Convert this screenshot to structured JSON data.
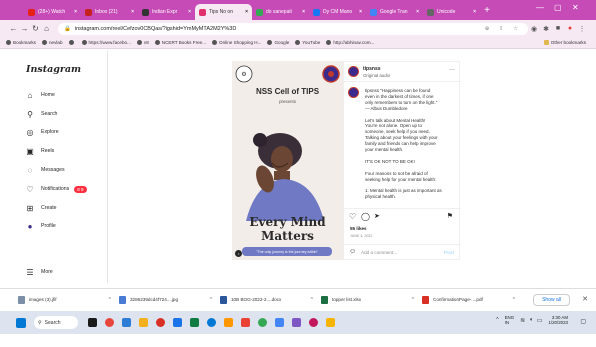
{
  "browser": {
    "tabs": [
      {
        "label": "(28+) Watch",
        "color": "#e62117",
        "active": false
      },
      {
        "label": "Inbox (21)",
        "color": "#c5221f",
        "active": false
      },
      {
        "label": "Indian Expr",
        "color": "#333333",
        "active": false
      },
      {
        "label": "Tips No on",
        "color": "#e1306c",
        "active": true
      },
      {
        "label": "do sanepati",
        "color": "#34a853",
        "active": false
      },
      {
        "label": "Dy CM Mano",
        "color": "#1877f2",
        "active": false
      },
      {
        "label": "Google Tran",
        "color": "#4285f4",
        "active": false
      },
      {
        "label": "Unicode",
        "color": "#666666",
        "active": false
      }
    ],
    "url": "instagram.com/reel/Cefzov0CBQas/?igshid=YmMyMTA2M2Y%3D",
    "bookmarks": [
      "Bookmarks",
      "nevlab",
      "",
      "https://www.facebo...",
      "v8",
      "NCERT Books Free...",
      "Online Shopping H...",
      "Google",
      "YouTube",
      "http://abhinav.com..."
    ],
    "other_bookmarks": "Other bookmarks"
  },
  "instagram": {
    "logo": "Instagram",
    "nav": [
      {
        "label": "Home",
        "icon": "home-icon"
      },
      {
        "label": "Search",
        "icon": "search-icon"
      },
      {
        "label": "Explore",
        "icon": "compass-icon"
      },
      {
        "label": "Reels",
        "icon": "reels-icon"
      },
      {
        "label": "Messages",
        "icon": "messenger-icon"
      },
      {
        "label": "Notifications",
        "icon": "heart-icon",
        "badge": "8 9"
      },
      {
        "label": "Create",
        "icon": "plus-square-icon"
      },
      {
        "label": "Profile",
        "icon": "profile-icon"
      }
    ],
    "more": "More",
    "post": {
      "title": "NSS Cell of TIPS",
      "presents": "presents",
      "headline_line1": "Every Mind",
      "headline_line2": "Matters",
      "quote_bar": "\"The only journey is the journey within\"",
      "username": "tipsnss",
      "audio": "Original audio",
      "caption_lines": [
        "tipsnss \"Happiness can be found",
        "even in the darkest of times, if one",
        "only remembers to turn on the light.\"",
        "— Albus Dumbledore",
        "",
        "Let's talk about Mental Health!",
        "You're not alone. Open up to",
        "someone, seek help if you need.",
        "Talking about your feelings with your",
        "family and friends can help improve",
        "your mental health.",
        "",
        "IT'S OK NOT TO BE OK!",
        "",
        "Four reasons to not be afraid of",
        "seeking help for your mental health:",
        "",
        "1. Mental health is just as important as",
        "physical health."
      ],
      "likes": "55 likes",
      "date": "JUNE 4, 2022",
      "comment_placeholder": "Add a comment...",
      "post_button": "Post"
    }
  },
  "downloads": {
    "items": [
      {
        "name": "images (3).jfif",
        "color": "#7b8fa6"
      },
      {
        "name": "3286239dcd4f724....jpg",
        "color": "#4a7bd4"
      },
      {
        "name": "10B BOG-2022-2....docx",
        "color": "#2b579a"
      },
      {
        "name": "topper list.xlsx",
        "color": "#1d6f42"
      },
      {
        "name": "ConfirmationPage-....pdf",
        "color": "#d93025"
      }
    ],
    "show_all": "Show all"
  },
  "taskbar": {
    "search": "Search",
    "app_colors": [
      "#1a1a1a",
      "#e8453c",
      "#2d7cd6",
      "#f2b01e",
      "#d93025",
      "#1a73e8",
      "#107c41",
      "#0078d4",
      "#ff9800",
      "#ea4335",
      "#34a853",
      "#4285f4",
      "#7e57c2",
      "#c2185b",
      "#f4b400"
    ],
    "lang": "ENG",
    "region": "IN",
    "time": "3:30 AM",
    "date": "1/20/2023"
  }
}
